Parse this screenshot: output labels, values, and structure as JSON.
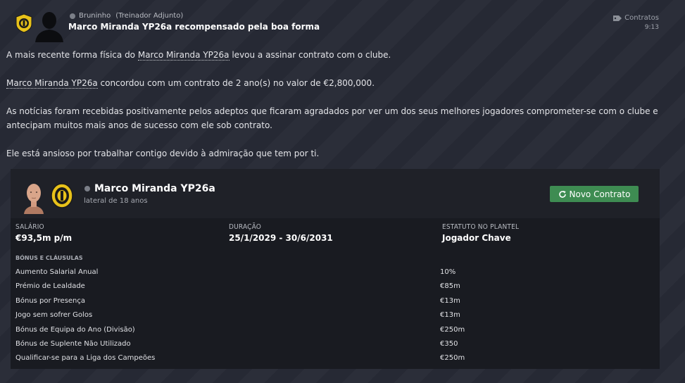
{
  "header": {
    "sender": "Bruninho",
    "sender_role": "(Treinador Adjunto)",
    "title": "Marco Miranda YP26a recompensado pela boa forma",
    "category": "Contratos",
    "time": "9:13"
  },
  "body": {
    "p1_pre": "A mais recente forma física do ",
    "p1_player": "Marco Miranda YP26a",
    "p1_post": " levou a assinar contrato com o clube.",
    "p2_player": "Marco Miranda YP26a",
    "p2_post": " concordou com um contrato de 2 ano(s) no valor de €2,800,000.",
    "p3": "As notícias foram recebidas positivamente pelos adeptos que ficaram agradados por ver um dos seus melhores jogadores comprometer-se com o clube e antecipam muitos mais anos de sucesso com ele sob contrato.",
    "p4": "Ele está ansioso por trabalhar contigo devido à admiração que tem por ti."
  },
  "card": {
    "player_name": "Marco Miranda YP26a",
    "player_sub": "lateral de 18 anos",
    "button_label": "Novo Contrato",
    "salary_label": "SALÁRIO",
    "salary_value": "€93,5m p/m",
    "duration_label": "DURAÇÃO",
    "duration_value": "25/1/2029 - 30/6/2031",
    "status_label": "ESTATUTO NO PLANTEL",
    "status_value": "Jogador Chave",
    "bonus_header": "BÓNUS E CLÁUSULAS",
    "bonuses": [
      {
        "name": "Aumento Salarial Anual",
        "value": "10%"
      },
      {
        "name": "Prémio de Lealdade",
        "value": "€85m"
      },
      {
        "name": "Bónus por Presença",
        "value": "€13m"
      },
      {
        "name": "Jogo sem sofrer Golos",
        "value": "€13m"
      },
      {
        "name": "Bónus de Equipa do Ano (Divisão)",
        "value": "€250m"
      },
      {
        "name": "Bónus de Suplente Não Utilizado",
        "value": "€350"
      },
      {
        "name": "Qualificar-se para a Liga dos Campeões",
        "value": "€250m"
      }
    ]
  },
  "colors": {
    "background": "#272a35",
    "card": "#1f2128",
    "accent_button": "#3e8c52",
    "crest_yellow": "#e8c21a"
  },
  "icons": [
    "club-crest-icon",
    "sender-silhouette-icon",
    "info-icon",
    "tag-icon",
    "refresh-icon",
    "player-face-icon"
  ]
}
